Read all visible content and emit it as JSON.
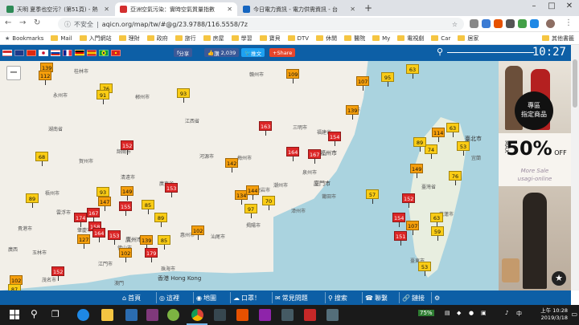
{
  "browser": {
    "tabs": [
      {
        "title": "天明 夏季也空污？(第51頁) - 熱",
        "active": false,
        "favicon_color": "#2e8b57"
      },
      {
        "title": "亞洲空氣污染：實時空氣質量指數",
        "active": true,
        "favicon_color": "#d32f2f"
      },
      {
        "title": "今日電力資訊 - 電力供需資訊 - 台",
        "active": false,
        "favicon_color": "#1565c0"
      }
    ],
    "new_tab": "+",
    "window_controls": [
      "–",
      "□",
      "✕"
    ],
    "security_label": "不安全",
    "url": "aqicn.org/map/tw/#@g/23.9788/116.5558/7z"
  },
  "bookmarks": [
    {
      "label": "Bookmarks",
      "kind": "star"
    },
    {
      "label": "Mail"
    },
    {
      "label": "入門網站"
    },
    {
      "label": "理財"
    },
    {
      "label": "政府"
    },
    {
      "label": "旅行"
    },
    {
      "label": "房屋"
    },
    {
      "label": "學習"
    },
    {
      "label": "寶貝"
    },
    {
      "label": "DTV"
    },
    {
      "label": "休閒"
    },
    {
      "label": "醫院"
    },
    {
      "label": "My"
    },
    {
      "label": "電視劇"
    },
    {
      "label": "Car"
    },
    {
      "label": "居家"
    }
  ],
  "bookmarks_more": "其他書籤",
  "site": {
    "flags": [
      "#d32f2f",
      "#1e3a8a",
      "#de2910",
      "#ffffff",
      "#c8102e",
      "#0039a6",
      "#ffffff",
      "#002395",
      "#dd0000",
      "#f1bf00",
      "#009c3b",
      "#da251d"
    ],
    "share_label": "分享",
    "like_count": "2,039",
    "like_label": "讚",
    "tweet_label": "推文",
    "share2_label": "Share",
    "clock": "10:27"
  },
  "map": {
    "cities": [
      {
        "name": "桂林市"
      },
      {
        "name": "永州市"
      },
      {
        "name": "郴州市"
      },
      {
        "name": "贛州市"
      },
      {
        "name": "韶關市"
      },
      {
        "name": "河源市"
      },
      {
        "name": "梅州市"
      },
      {
        "name": "龍岩市"
      },
      {
        "name": "三明市"
      },
      {
        "name": "南平市"
      },
      {
        "name": "福州市"
      },
      {
        "name": "莆田市"
      },
      {
        "name": "泉州市"
      },
      {
        "name": "廈門市"
      },
      {
        "name": "漳州市"
      },
      {
        "name": "潮州市"
      },
      {
        "name": "汕頭市"
      },
      {
        "name": "揭陽市"
      },
      {
        "name": "汕尾市"
      },
      {
        "name": "惠州市"
      },
      {
        "name": "廣州市"
      },
      {
        "name": "肇慶市"
      },
      {
        "name": "佛山市"
      },
      {
        "name": "清遠市"
      },
      {
        "name": "雲浮市"
      },
      {
        "name": "梧州市"
      },
      {
        "name": "賀州市"
      },
      {
        "name": "貴港市"
      },
      {
        "name": "玉林市"
      },
      {
        "name": "茂名市"
      },
      {
        "name": "江門市"
      },
      {
        "name": "珠海市"
      },
      {
        "name": "香港 Hong Kong"
      },
      {
        "name": "澳門"
      },
      {
        "name": "臺灣省"
      },
      {
        "name": "福建省"
      },
      {
        "name": "廣東省"
      },
      {
        "name": "江西省"
      },
      {
        "name": "湖南省"
      },
      {
        "name": "廣西"
      },
      {
        "name": "臺東市"
      },
      {
        "name": "花蓮市"
      },
      {
        "name": "臺北市"
      },
      {
        "name": "宜蘭"
      }
    ],
    "stations": [
      {
        "aqi": "139",
        "color": "#f59e0b"
      },
      {
        "aqi": "112",
        "color": "#f59e0b"
      },
      {
        "aqi": "76",
        "color": "#facc15"
      },
      {
        "aqi": "91",
        "color": "#facc15"
      },
      {
        "aqi": "93",
        "color": "#facc15"
      },
      {
        "aqi": "109",
        "color": "#f59e0b"
      },
      {
        "aqi": "107",
        "color": "#f59e0b"
      },
      {
        "aqi": "95",
        "color": "#facc15"
      },
      {
        "aqi": "63",
        "color": "#facc15"
      },
      {
        "aqi": "139",
        "color": "#f59e0b"
      },
      {
        "aqi": "163",
        "color": "#dc2626"
      },
      {
        "aqi": "152",
        "color": "#dc2626"
      },
      {
        "aqi": "154",
        "color": "#dc2626"
      },
      {
        "aqi": "164",
        "color": "#dc2626"
      },
      {
        "aqi": "167",
        "color": "#dc2626"
      },
      {
        "aqi": "68",
        "color": "#facc15"
      },
      {
        "aqi": "142",
        "color": "#f59e0b"
      },
      {
        "aqi": "114",
        "color": "#f59e0b"
      },
      {
        "aqi": "63",
        "color": "#facc15"
      },
      {
        "aqi": "53",
        "color": "#facc15"
      },
      {
        "aqi": "74",
        "color": "#facc15"
      },
      {
        "aqi": "89",
        "color": "#facc15"
      },
      {
        "aqi": "149",
        "color": "#f59e0b"
      },
      {
        "aqi": "76",
        "color": "#facc15"
      },
      {
        "aqi": "93",
        "color": "#facc15"
      },
      {
        "aqi": "149",
        "color": "#f59e0b"
      },
      {
        "aqi": "153",
        "color": "#dc2626"
      },
      {
        "aqi": "134",
        "color": "#f59e0b"
      },
      {
        "aqi": "144",
        "color": "#f59e0b"
      },
      {
        "aqi": "70",
        "color": "#facc15"
      },
      {
        "aqi": "97",
        "color": "#facc15"
      },
      {
        "aqi": "57",
        "color": "#facc15"
      },
      {
        "aqi": "152",
        "color": "#dc2626"
      },
      {
        "aqi": "89",
        "color": "#facc15"
      },
      {
        "aqi": "147",
        "color": "#f59e0b"
      },
      {
        "aqi": "155",
        "color": "#dc2626"
      },
      {
        "aqi": "174",
        "color": "#dc2626"
      },
      {
        "aqi": "167",
        "color": "#dc2626"
      },
      {
        "aqi": "158",
        "color": "#dc2626"
      },
      {
        "aqi": "85",
        "color": "#facc15"
      },
      {
        "aqi": "89",
        "color": "#facc15"
      },
      {
        "aqi": "154",
        "color": "#dc2626"
      },
      {
        "aqi": "63",
        "color": "#facc15"
      },
      {
        "aqi": "164",
        "color": "#dc2626"
      },
      {
        "aqi": "127",
        "color": "#f59e0b"
      },
      {
        "aqi": "153",
        "color": "#dc2626"
      },
      {
        "aqi": "102",
        "color": "#f59e0b"
      },
      {
        "aqi": "107",
        "color": "#f59e0b"
      },
      {
        "aqi": "59",
        "color": "#facc15"
      },
      {
        "aqi": "139",
        "color": "#f59e0b"
      },
      {
        "aqi": "85",
        "color": "#facc15"
      },
      {
        "aqi": "151",
        "color": "#dc2626"
      },
      {
        "aqi": "102",
        "color": "#f59e0b"
      },
      {
        "aqi": "179",
        "color": "#dc2626"
      },
      {
        "aqi": "53",
        "color": "#facc15"
      },
      {
        "aqi": "102",
        "color": "#f59e0b"
      },
      {
        "aqi": "152",
        "color": "#dc2626"
      },
      {
        "aqi": "87",
        "color": "#facc15"
      }
    ]
  },
  "ad": {
    "badge_line1": "專區",
    "badge_line2": "指定商品",
    "max_label": "MAX",
    "percent": "50%",
    "off_label": "OFF",
    "sub1": "More Sale",
    "sub2": "usagi-online"
  },
  "bottom_nav": [
    {
      "label": "首頁",
      "icon": "home-icon"
    },
    {
      "label": "這裡",
      "icon": "location-icon"
    },
    {
      "label": "地圖",
      "icon": "map-icon"
    },
    {
      "label": "口罩！",
      "icon": "mask-icon"
    },
    {
      "label": "常見問題",
      "icon": "faq-icon"
    },
    {
      "label": "搜索",
      "icon": "search-icon"
    },
    {
      "label": "聯繫",
      "icon": "contact-icon"
    },
    {
      "label": "鏈接",
      "icon": "link-icon"
    },
    {
      "label": "",
      "icon": "settings-icon"
    }
  ],
  "taskbar": {
    "battery": "75%",
    "time_line1": "上午 10:28",
    "time_line2": "2019/3/18"
  }
}
